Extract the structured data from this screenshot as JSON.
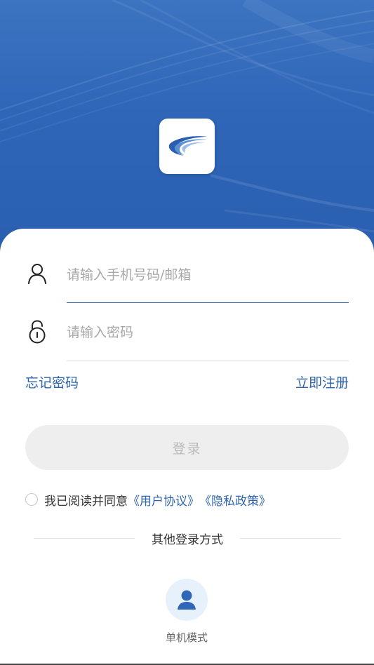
{
  "app": {
    "logo_name": "app-logo"
  },
  "login": {
    "account_placeholder": "请输入手机号码/邮箱",
    "account_value": "",
    "password_placeholder": "请输入密码",
    "password_value": "",
    "forgot_label": "忘记密码",
    "register_label": "立即注册",
    "submit_label": "登录"
  },
  "agreement": {
    "checked": false,
    "prefix": "我已阅读并同意",
    "user_agreement": "《用户协议》",
    "privacy_policy": "《隐私政策》"
  },
  "other_login": {
    "title": "其他登录方式",
    "offline_label": "单机模式"
  },
  "colors": {
    "brand": "#2f66b8",
    "link": "#2d64ae",
    "button_disabled_bg": "#eeeeee",
    "button_disabled_text": "#b9b9b9",
    "offline_bg": "#e6f1fb"
  },
  "icons": {
    "account": "user-icon",
    "password": "lock-icon",
    "offline": "person-icon"
  }
}
